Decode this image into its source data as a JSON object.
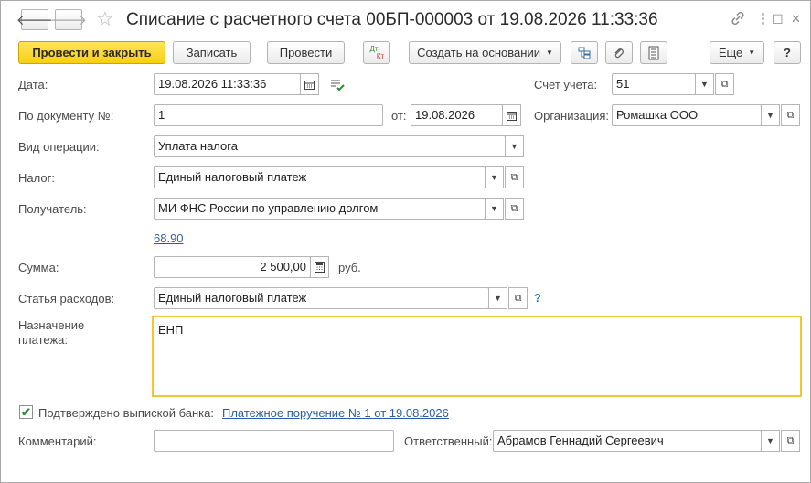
{
  "window": {
    "title": "Списание с расчетного счета 00БП-000003 от 19.08.2026 11:33:36",
    "back_glyph": "🡐",
    "forward_glyph": "🡒",
    "star_glyph": "☆",
    "link_glyph": "🔗",
    "menu_glyph": "⋮",
    "maximize_glyph": "☐",
    "close_glyph": "✕"
  },
  "toolbar": {
    "post_and_close": "Провести и закрыть",
    "write": "Записать",
    "post": "Провести",
    "dt_label": "Дт",
    "kt_label": "Кт",
    "create_based_on": "Создать на основании",
    "more": "Еще",
    "help": "?"
  },
  "form": {
    "date_label": "Дата:",
    "date_value": "19.08.2026 11:33:36",
    "account_label": "Счет учета:",
    "account_value": "51",
    "doc_number_label": "По документу №:",
    "doc_number_value": "1",
    "doc_from_label": "от:",
    "doc_date_value": "19.08.2026",
    "organization_label": "Организация:",
    "organization_value": "Ромашка ООО",
    "operation_label": "Вид операции:",
    "operation_value": "Уплата налога",
    "tax_label": "Налог:",
    "tax_value": "Единый налоговый платеж",
    "recipient_label": "Получатель:",
    "recipient_value": "МИ ФНС России по управлению долгом",
    "recipient_account_link": "68.90",
    "sum_label": "Сумма:",
    "sum_value": "2 500,00",
    "currency": "руб.",
    "expense_label": "Статья расходов:",
    "expense_value": "Единый налоговый платеж",
    "expense_help": "?",
    "purpose_label": "Назначение платежа:",
    "purpose_value": "ЕНП",
    "confirmed_label": "Подтверждено выпиской банка:",
    "confirmed_checked": "✔",
    "payment_order_link": "Платежное поручение № 1 от 19.08.2026",
    "comment_label": "Комментарий:",
    "comment_value": "",
    "responsible_label": "Ответственный:",
    "responsible_value": "Абрамов Геннадий Сергеевич"
  },
  "colors": {
    "primary_button": "#f7cf10",
    "link": "#2a5ea8",
    "active_border": "#f2c630",
    "check": "#2e8b2e"
  }
}
